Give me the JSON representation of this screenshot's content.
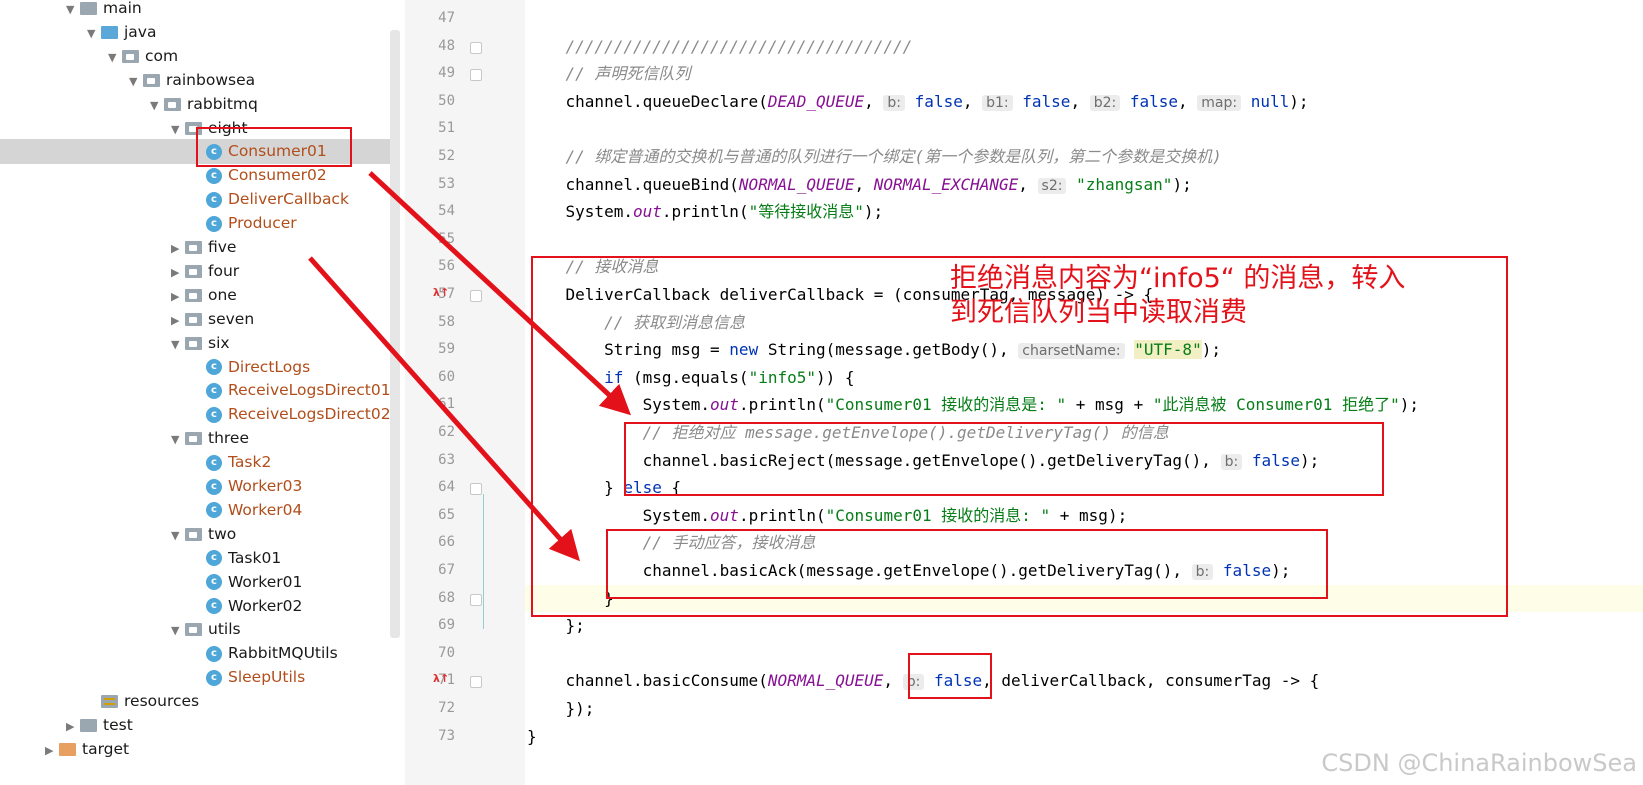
{
  "project_tree": {
    "items": [
      {
        "label": "main",
        "indent": 0,
        "kind": "folder",
        "expanded": true
      },
      {
        "label": "java",
        "indent": 1,
        "kind": "src",
        "expanded": true
      },
      {
        "label": "com",
        "indent": 2,
        "kind": "pkg",
        "expanded": true
      },
      {
        "label": "rainbowsea",
        "indent": 3,
        "kind": "pkg",
        "expanded": true
      },
      {
        "label": "rabbitmq",
        "indent": 4,
        "kind": "pkg",
        "expanded": true
      },
      {
        "label": "eight",
        "indent": 5,
        "kind": "pkg",
        "expanded": true
      },
      {
        "label": "Consumer01",
        "indent": 6,
        "kind": "class",
        "ext": true,
        "selected": true
      },
      {
        "label": "Consumer02",
        "indent": 6,
        "kind": "class",
        "ext": true
      },
      {
        "label": "DeliverCallback",
        "indent": 6,
        "kind": "class",
        "ext": true
      },
      {
        "label": "Producer",
        "indent": 6,
        "kind": "class",
        "ext": true
      },
      {
        "label": "five",
        "indent": 5,
        "kind": "pkg",
        "expanded": false
      },
      {
        "label": "four",
        "indent": 5,
        "kind": "pkg",
        "expanded": false
      },
      {
        "label": "one",
        "indent": 5,
        "kind": "pkg",
        "expanded": false
      },
      {
        "label": "seven",
        "indent": 5,
        "kind": "pkg",
        "expanded": false
      },
      {
        "label": "six",
        "indent": 5,
        "kind": "pkg",
        "expanded": true
      },
      {
        "label": "DirectLogs",
        "indent": 6,
        "kind": "class",
        "ext": true
      },
      {
        "label": "ReceiveLogsDirect01",
        "indent": 6,
        "kind": "class",
        "ext": true
      },
      {
        "label": "ReceiveLogsDirect02",
        "indent": 6,
        "kind": "class",
        "ext": true
      },
      {
        "label": "three",
        "indent": 5,
        "kind": "pkg",
        "expanded": true
      },
      {
        "label": "Task2",
        "indent": 6,
        "kind": "class",
        "ext": true
      },
      {
        "label": "Worker03",
        "indent": 6,
        "kind": "class",
        "ext": true
      },
      {
        "label": "Worker04",
        "indent": 6,
        "kind": "class",
        "ext": true
      },
      {
        "label": "two",
        "indent": 5,
        "kind": "pkg",
        "expanded": true
      },
      {
        "label": "Task01",
        "indent": 6,
        "kind": "class",
        "ext": false
      },
      {
        "label": "Worker01",
        "indent": 6,
        "kind": "class",
        "ext": false
      },
      {
        "label": "Worker02",
        "indent": 6,
        "kind": "class",
        "ext": false
      },
      {
        "label": "utils",
        "indent": 5,
        "kind": "pkg",
        "expanded": true
      },
      {
        "label": "RabbitMQUtils",
        "indent": 6,
        "kind": "class",
        "ext": false
      },
      {
        "label": "SleepUtils",
        "indent": 6,
        "kind": "class",
        "ext": true
      },
      {
        "label": "resources",
        "indent": 1,
        "kind": "res"
      },
      {
        "label": "test",
        "indent": 0,
        "kind": "folder",
        "expanded": false
      },
      {
        "label": "target",
        "indent": -1,
        "kind": "tgt",
        "expanded": false
      }
    ]
  },
  "editor": {
    "line_numbers": [
      "47",
      "48",
      "49",
      "50",
      "51",
      "52",
      "53",
      "54",
      "55",
      "56",
      "57",
      "58",
      "59",
      "60",
      "61",
      "62",
      "63",
      "64",
      "65",
      "66",
      "67",
      "68",
      "69",
      "70",
      "71",
      "72",
      "73"
    ],
    "lines": [
      {
        "segs": []
      },
      {
        "segs": [
          {
            "t": "    ////////////////////////////////////",
            "c": "cm"
          }
        ]
      },
      {
        "segs": [
          {
            "t": "    // 声明死信队列",
            "c": "cm"
          }
        ]
      },
      {
        "segs": [
          {
            "t": "    channel.queueDeclare("
          },
          {
            "t": "DEAD_QUEUE",
            "c": "fld"
          },
          {
            "t": ", "
          },
          {
            "t": "b:",
            "c": "hint"
          },
          {
            "t": " "
          },
          {
            "t": "false",
            "c": "kw"
          },
          {
            "t": ", "
          },
          {
            "t": "b1:",
            "c": "hint"
          },
          {
            "t": " "
          },
          {
            "t": "false",
            "c": "kw"
          },
          {
            "t": ", "
          },
          {
            "t": "b2:",
            "c": "hint"
          },
          {
            "t": " "
          },
          {
            "t": "false",
            "c": "kw"
          },
          {
            "t": ", "
          },
          {
            "t": "map:",
            "c": "hint"
          },
          {
            "t": " "
          },
          {
            "t": "null",
            "c": "kw"
          },
          {
            "t": ");"
          }
        ]
      },
      {
        "segs": []
      },
      {
        "segs": [
          {
            "t": "    // 绑定普通的交换机与普通的队列进行一个绑定(第一个参数是队列，第二个参数是交换机)",
            "c": "cm"
          }
        ]
      },
      {
        "segs": [
          {
            "t": "    channel.queueBind("
          },
          {
            "t": "NORMAL_QUEUE",
            "c": "fld"
          },
          {
            "t": ", "
          },
          {
            "t": "NORMAL_EXCHANGE",
            "c": "fld"
          },
          {
            "t": ", "
          },
          {
            "t": "s2:",
            "c": "hint"
          },
          {
            "t": " "
          },
          {
            "t": "\"zhangsan\"",
            "c": "st"
          },
          {
            "t": ");"
          }
        ]
      },
      {
        "segs": [
          {
            "t": "    System."
          },
          {
            "t": "out",
            "c": "fld"
          },
          {
            "t": ".println("
          },
          {
            "t": "\"等待接收消息\"",
            "c": "st"
          },
          {
            "t": ");"
          }
        ]
      },
      {
        "segs": []
      },
      {
        "segs": [
          {
            "t": "    // 接收消息",
            "c": "cm"
          }
        ]
      },
      {
        "segs": [
          {
            "t": "    DeliverCallback deliverCallback = (consumerTag, message) -> {"
          }
        ]
      },
      {
        "segs": [
          {
            "t": "        // 获取到消息信息",
            "c": "cm"
          }
        ]
      },
      {
        "segs": [
          {
            "t": "        String msg = "
          },
          {
            "t": "new",
            "c": "kw"
          },
          {
            "t": " String(message.getBody(), "
          },
          {
            "t": "charsetName:",
            "c": "hint"
          },
          {
            "t": " "
          },
          {
            "t": "\"UTF-8\"",
            "c": "st strhl"
          },
          {
            "t": ");"
          }
        ]
      },
      {
        "segs": [
          {
            "t": "        "
          },
          {
            "t": "if",
            "c": "kw"
          },
          {
            "t": " (msg.equals("
          },
          {
            "t": "\"info5\"",
            "c": "st"
          },
          {
            "t": ")) {"
          }
        ]
      },
      {
        "segs": [
          {
            "t": "            System."
          },
          {
            "t": "out",
            "c": "fld"
          },
          {
            "t": ".println("
          },
          {
            "t": "\"Consumer01 接收的消息是: \"",
            "c": "st"
          },
          {
            "t": " + msg + "
          },
          {
            "t": "\"此消息被 Consumer01 拒绝了\"",
            "c": "st"
          },
          {
            "t": ");"
          }
        ]
      },
      {
        "segs": [
          {
            "t": "            // 拒绝对应 message.getEnvelope().getDeliveryTag() 的信息",
            "c": "cm"
          }
        ]
      },
      {
        "segs": [
          {
            "t": "            channel.basicReject(message.getEnvelope().getDeliveryTag(), "
          },
          {
            "t": "b:",
            "c": "hint"
          },
          {
            "t": " "
          },
          {
            "t": "false",
            "c": "kw"
          },
          {
            "t": ");"
          }
        ]
      },
      {
        "segs": [
          {
            "t": "        } "
          },
          {
            "t": "else",
            "c": "kw"
          },
          {
            "t": " {"
          }
        ]
      },
      {
        "segs": [
          {
            "t": "            System."
          },
          {
            "t": "out",
            "c": "fld"
          },
          {
            "t": ".println("
          },
          {
            "t": "\"Consumer01 接收的消息: \"",
            "c": "st"
          },
          {
            "t": " + msg);"
          }
        ]
      },
      {
        "segs": [
          {
            "t": "            // 手动应答，接收消息",
            "c": "cm"
          }
        ]
      },
      {
        "segs": [
          {
            "t": "            channel.basicAck(message.getEnvelope().getDeliveryTag(), "
          },
          {
            "t": "b:",
            "c": "hint"
          },
          {
            "t": " "
          },
          {
            "t": "false",
            "c": "kw"
          },
          {
            "t": ");"
          }
        ]
      },
      {
        "segs": [
          {
            "t": "        }"
          }
        ],
        "highlight": true
      },
      {
        "segs": [
          {
            "t": "    };"
          }
        ]
      },
      {
        "segs": []
      },
      {
        "segs": [
          {
            "t": "    channel.basicConsume("
          },
          {
            "t": "NORMAL_QUEUE",
            "c": "fld"
          },
          {
            "t": ", "
          },
          {
            "t": "b:",
            "c": "hint"
          },
          {
            "t": " "
          },
          {
            "t": "false",
            "c": "kw"
          },
          {
            "t": ", deliverCallback, consumerTag -> {"
          }
        ]
      },
      {
        "segs": [
          {
            "t": "    });"
          }
        ]
      },
      {
        "segs": [
          {
            "t": "}"
          }
        ]
      }
    ]
  },
  "annotation": {
    "line1": "拒绝消息内容为“info5“ 的消息，转入",
    "line2": "到死信队列当中读取消费",
    "color": "#e3121a"
  },
  "watermark": "CSDN @ChinaRainbowSea"
}
